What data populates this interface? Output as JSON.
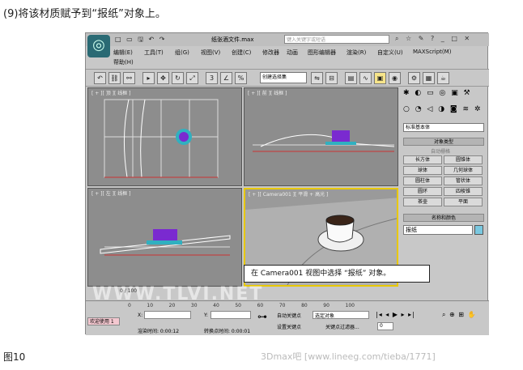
{
  "caption_top": "(9)将该材质赋予到“报纸”对象上。",
  "caption_bottom": "图10",
  "watermark_bottom": "3Dmax吧 [www.lineeg.com/tieba/1771]",
  "watermark_mid": "WWW.TLVI.NET",
  "app": {
    "doc_title": "纸张酒文件.max",
    "search_placeholder": "键入关键字或短语",
    "menus": [
      "编辑(E)",
      "工具(T)",
      "组(G)",
      "视图(V)",
      "创建(C)",
      "修改器",
      "动画",
      "图形编辑器",
      "渲染(R)",
      "自定义(U)",
      "MAXScript(M)",
      "帮助(H)"
    ],
    "selection_dropdown": "创建选择集",
    "viewports": [
      {
        "label": "[ + ][ 顶 ][ 线框 ]"
      },
      {
        "label": "[ + ][ 前 ][ 线框 ]"
      },
      {
        "label": "[ + ][ 左 ][ 线框 ]"
      },
      {
        "label": "[ + ][ Camera001 ][ 平滑 + 高光 ]"
      }
    ],
    "command_panel": {
      "dropdown": "标准基本体",
      "object_type_title": "对象类型",
      "autogrid": "自动栅格",
      "buttons": [
        "长方体",
        "圆锥体",
        "球体",
        "几何球体",
        "圆柱体",
        "管状体",
        "圆环",
        "四棱锥",
        "茶壶",
        "平面"
      ],
      "name_color_title": "名称和颜色",
      "name_value": "报纸"
    },
    "callout": "在 Camera001 视图中选择 “报纸” 对象。",
    "status": {
      "timeline": "0 / 100",
      "welcome": "欢迎使用 1",
      "render_time": "渲染时间: 0:00:12",
      "convert_time": "转换点时间: 0:00:01",
      "auto_key": "自动关键点",
      "set_key": "设置关键点",
      "filter": "关键点过滤器...",
      "selected": "选定对象",
      "x_label": "X:",
      "y_label": "Y:",
      "frame_value": "0",
      "ticks": [
        "0",
        "10",
        "20",
        "30",
        "40",
        "50",
        "60",
        "70",
        "80",
        "90",
        "100"
      ]
    }
  }
}
